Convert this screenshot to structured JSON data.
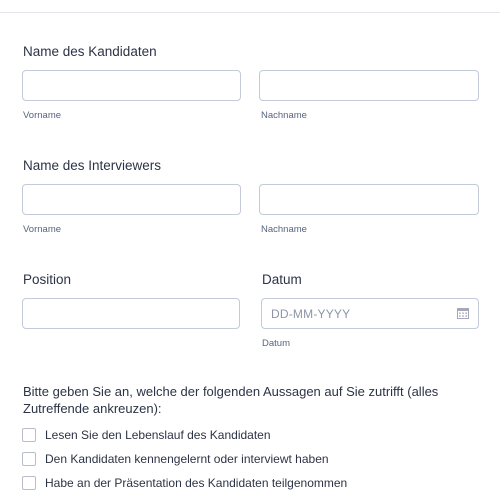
{
  "candidate": {
    "label": "Name des Kandidaten",
    "first_sub": "Vorname",
    "last_sub": "Nachname"
  },
  "interviewer": {
    "label": "Name des Interviewers",
    "first_sub": "Vorname",
    "last_sub": "Nachname"
  },
  "position": {
    "label": "Position"
  },
  "date": {
    "label": "Datum",
    "placeholder": "DD-MM-YYYY",
    "sub": "Datum"
  },
  "statements": {
    "question": "Bitte geben Sie an, welche der folgenden Aussagen auf Sie zutrifft (alles Zutreffende ankreuzen):",
    "options": [
      "Lesen Sie den Lebenslauf des Kandidaten",
      "Den Kandidaten kennengelernt oder interviewt haben",
      "Habe an der Präsentation des Kandidaten teilgenommen"
    ]
  },
  "icons": {
    "date_picker": "calendar-icon"
  },
  "colors": {
    "text": "#2c3345",
    "border": "#c3cad8",
    "subtext": "#57647e"
  }
}
